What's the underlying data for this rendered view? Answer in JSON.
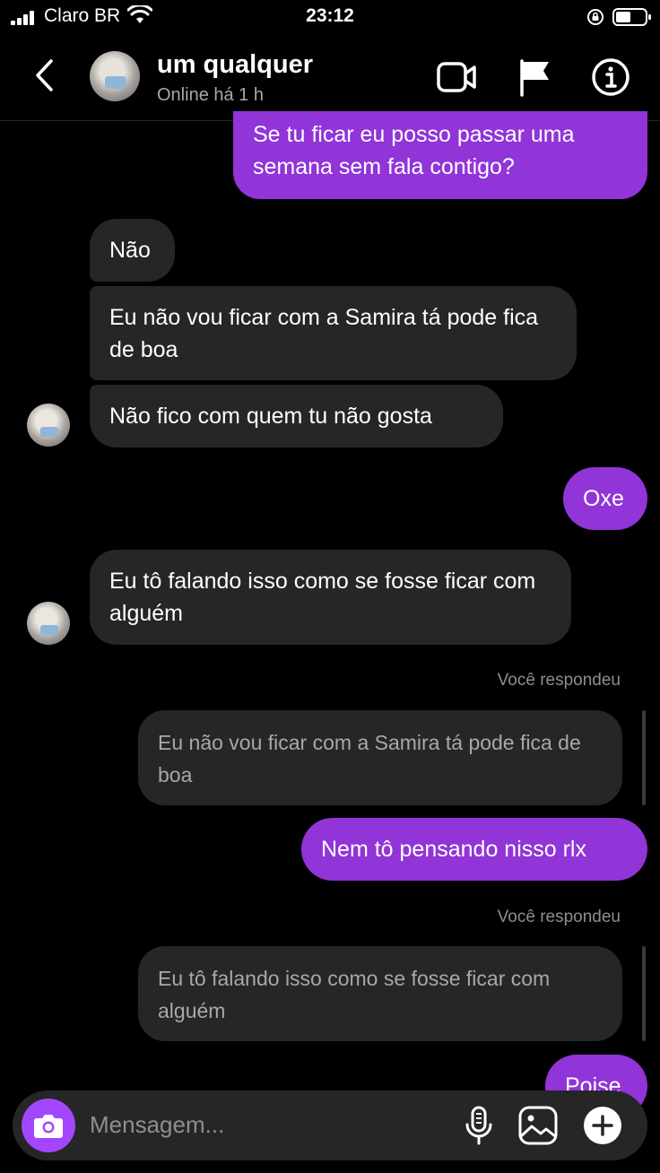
{
  "status_bar": {
    "carrier": "Claro BR",
    "time": "23:12"
  },
  "header": {
    "contact_name": "um qualquer",
    "contact_status": "Online há 1 h"
  },
  "messages": [
    {
      "from": "me",
      "text": "Se tu ficar eu posso passar uma semana sem fala contigo?"
    },
    {
      "from": "them",
      "text": "Não"
    },
    {
      "from": "them",
      "text": "Eu não vou ficar com a Samira tá pode fica de boa"
    },
    {
      "from": "them",
      "text": "Não fico com quem tu não gosta"
    },
    {
      "from": "me",
      "text": "Oxe"
    },
    {
      "from": "them",
      "text": "Eu tô falando isso como se fosse ficar com alguém"
    },
    {
      "from": "me",
      "reply_label": "Você respondeu",
      "quoted": "Eu não vou ficar com a Samira tá pode fica de boa",
      "text": "Nem tô pensando nisso rlx"
    },
    {
      "from": "me",
      "reply_label": "Você respondeu",
      "quoted": "Eu tô falando isso como se fosse ficar com alguém",
      "text": "Poise"
    }
  ],
  "composer": {
    "placeholder": "Mensagem..."
  },
  "colors": {
    "my_bubble": "#9134d8",
    "their_bubble": "#262626",
    "camera_button": "#a347ff"
  },
  "icons": [
    "back-icon",
    "video-call-icon",
    "flag-icon",
    "info-icon",
    "camera-icon",
    "microphone-icon",
    "gallery-icon",
    "plus-icon"
  ]
}
